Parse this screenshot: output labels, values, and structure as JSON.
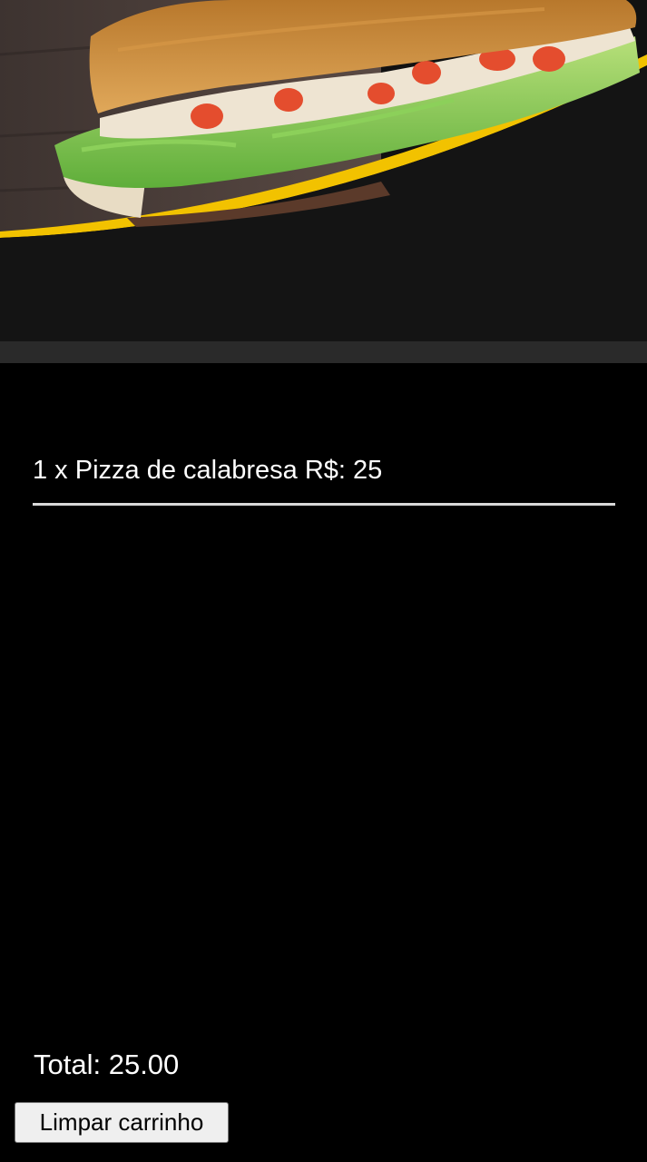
{
  "hero": {
    "image_subject": "sandwich-photo",
    "colors": {
      "background": "#111111",
      "accent_stripe": "#f2c200",
      "bread": "#c88a3a",
      "lettuce": "#79c24a",
      "tomato": "#e44d2e"
    }
  },
  "cart": {
    "items": [
      {
        "quantity": "1",
        "name": "Pizza de calabresa",
        "price_label": "R$: 25",
        "line_text": "1 x Pizza de calabresa R$: 25"
      }
    ],
    "total_text": "Total: 25.00",
    "clear_button_label": "Limpar carrinho"
  },
  "colors": {
    "page_background": "#000000",
    "text": "#ffffff",
    "divider": "#d9d9d9",
    "button_background": "#efefef"
  }
}
